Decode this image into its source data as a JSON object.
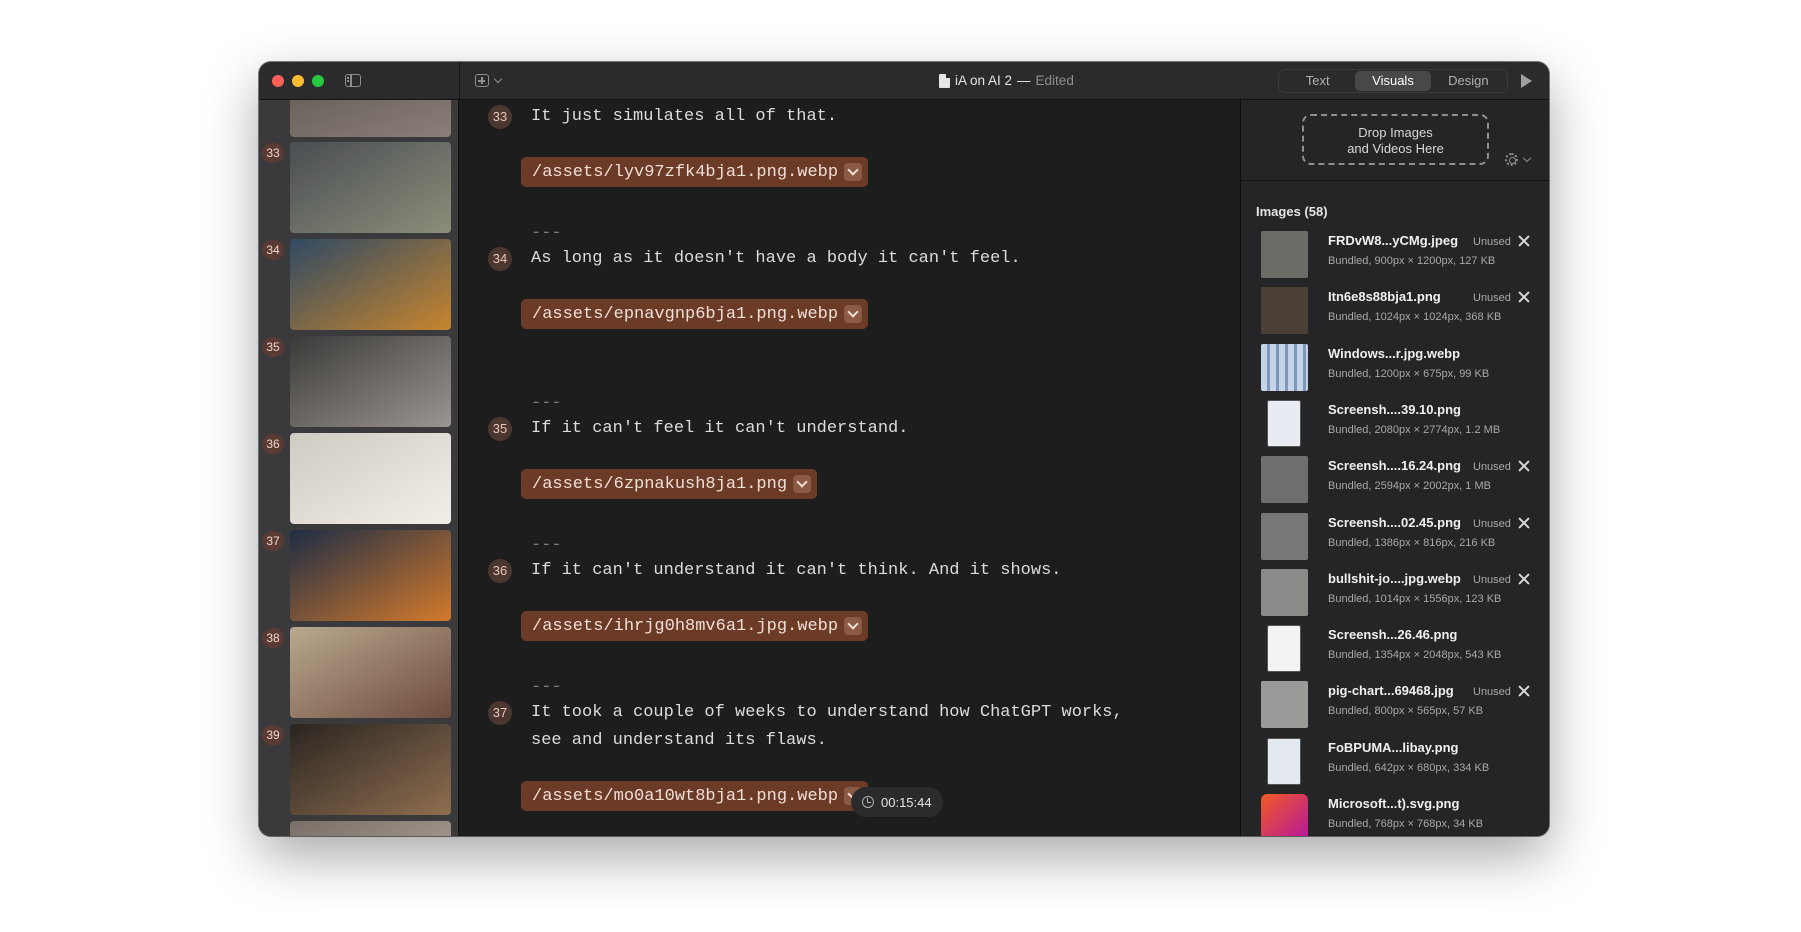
{
  "window": {
    "title": "iA on AI 2",
    "title_separator": "—",
    "status": "Edited"
  },
  "toolbar": {
    "tabs": [
      "Text",
      "Visuals",
      "Design"
    ],
    "active_tab": "Visuals"
  },
  "sidebar": {
    "thumbnails": [
      {
        "number": "33",
        "color": [
          "#4a4d52",
          "#8a8f7a"
        ]
      },
      {
        "number": "34",
        "color": [
          "#2f4a63",
          "#c7852e"
        ]
      },
      {
        "number": "35",
        "color": [
          "#3b3a38",
          "#9b9591"
        ]
      },
      {
        "number": "36",
        "color": [
          "#cfcac2",
          "#f2efe9"
        ]
      },
      {
        "number": "37",
        "color": [
          "#1e2d45",
          "#d37a2c"
        ]
      },
      {
        "number": "38",
        "color": [
          "#b9a98f",
          "#6e4b3e"
        ]
      },
      {
        "number": "39",
        "color": [
          "#2a2521",
          "#8f6e4f"
        ]
      }
    ]
  },
  "editor": {
    "paragraphs": [
      {
        "number": "33",
        "text": "It just simulates all of that.",
        "asset": "/assets/lyv97zfk4bja1.png.webp"
      },
      {
        "number": "34",
        "text": "As long as it doesn't have a body it can't feel.",
        "asset": "/assets/epnavgnp6bja1.png.webp"
      },
      {
        "number": "35",
        "text": "If it can't feel it can't understand.",
        "asset": "/assets/6zpnakush8ja1.png"
      },
      {
        "number": "36",
        "text": "If it can't understand it can't think. And it shows.",
        "asset": "/assets/ihrjg0h8mv6a1.jpg.webp"
      },
      {
        "number": "37",
        "text": "It took a couple of weeks to understand how ChatGPT works,",
        "text2": "see and understand its flaws.",
        "asset": "/assets/mo0a10wt8bja1.png.webp"
      }
    ],
    "separator": "---",
    "timer": "00:15:44"
  },
  "panel": {
    "drop_zone_line1": "Drop Images",
    "drop_zone_line2": "and Videos Here",
    "images_header": "Images (58)",
    "unused_label": "Unused",
    "images": [
      {
        "name": "FRDvW8...yCMg.jpeg",
        "meta": "Bundled, 900px × 1200px, 127 KB",
        "unused": true,
        "thumb": "#6b6b68"
      },
      {
        "name": "Itn6e8s88bja1.png",
        "meta": "Bundled, 1024px × 1024px, 368 KB",
        "unused": true,
        "thumb": "#4a4036"
      },
      {
        "name": "Windows...r.jpg.webp",
        "meta": "Bundled, 1200px × 675px, 99 KB",
        "unused": false,
        "thumb": "#8fa8c9"
      },
      {
        "name": "Screensh....39.10.png",
        "meta": "Bundled, 2080px × 2774px, 1.2 MB",
        "unused": false,
        "thumb": "#e8ecf2"
      },
      {
        "name": "Screensh....16.24.png",
        "meta": "Bundled, 2594px × 2002px, 1 MB",
        "unused": true,
        "thumb": "#6e6e70"
      },
      {
        "name": "Screensh....02.45.png",
        "meta": "Bundled, 1386px × 816px, 216 KB",
        "unused": true,
        "thumb": "#77777a"
      },
      {
        "name": "bullshit-jo....jpg.webp",
        "meta": "Bundled, 1014px × 1556px, 123 KB",
        "unused": true,
        "thumb": "#8a8a88"
      },
      {
        "name": "Screensh...26.46.png",
        "meta": "Bundled, 1354px × 2048px, 543 KB",
        "unused": false,
        "thumb": "#f3f3f3"
      },
      {
        "name": "pig-chart...69468.jpg",
        "meta": "Bundled, 800px × 565px, 57 KB",
        "unused": true,
        "thumb": "#9a9a98"
      },
      {
        "name": "FoBPUMA...libay.png",
        "meta": "Bundled, 642px × 680px, 334 KB",
        "unused": false,
        "thumb": "#e4e8f0"
      },
      {
        "name": "Microsoft...t).svg.png",
        "meta": "Bundled, 768px × 768px, 34 KB",
        "unused": false,
        "thumb": "#d64a22"
      }
    ]
  }
}
